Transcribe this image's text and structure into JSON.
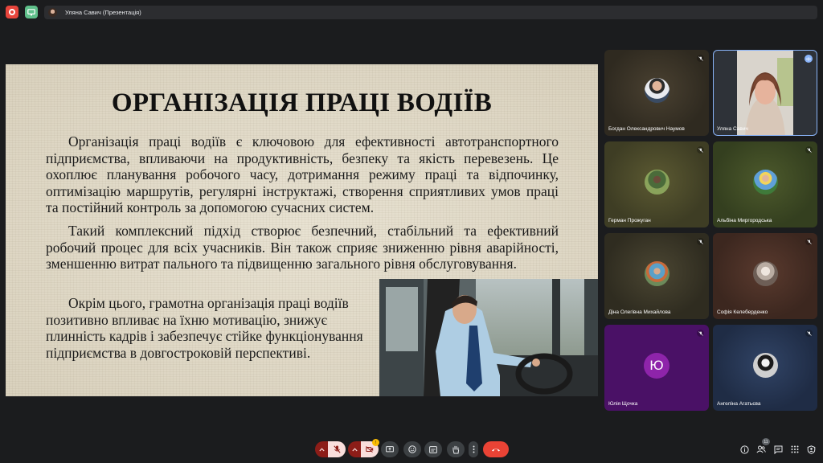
{
  "topbar": {
    "presentation_label": "Уляна Савич (Презентація)"
  },
  "slide": {
    "title": "ОРГАНІЗАЦІЯ ПРАЦІ ВОДІЇВ",
    "paragraph1": "Організація праці водіїв є ключовою для ефективності автотранспортного підприємства, впливаючи на продуктивність, безпеку та якість перевезень. Це охоплює планування робочого часу, дотримання режиму праці та відпочинку, оптимізацію маршрутів, регулярні інструктажі, створення сприятливих умов праці та постійний контроль за допомогою сучасних систем.",
    "paragraph2": "Такий комплексний підхід створює безпечний, стабільний та ефективний робочий процес для всіх учасників. Він також сприяє зниженню рівня аварійності, зменшенню витрат пального та підвищенню загального рівня обслуговування.",
    "paragraph3": "Окрім цього, грамотна організація праці водіїв позитивно впливає на їхню мотивацію, знижує плинність кадрів і забезпечує стійке функціонування підприємства в довгостроковій перспективі."
  },
  "participants": [
    {
      "name": "Богдан Олександрович Наумов",
      "kind": "photo",
      "muted": true
    },
    {
      "name": "Уляна Савич",
      "kind": "video",
      "muted": false,
      "speaking": true
    },
    {
      "name": "Герман Прожуган",
      "kind": "photo",
      "muted": true
    },
    {
      "name": "Альбіна Миргородська",
      "kind": "photo",
      "muted": true
    },
    {
      "name": "Діна Олегівна Михайлова",
      "kind": "photo",
      "muted": true
    },
    {
      "name": "Софія Келеберденко",
      "kind": "photo",
      "muted": true
    },
    {
      "name": "Юлія Щочка",
      "kind": "letter",
      "letter": "Ю",
      "muted": true
    },
    {
      "name": "Ангеліна Агатьєва",
      "kind": "photo",
      "muted": true
    }
  ],
  "controls": {
    "camera_badge": "!",
    "people_count": "11"
  },
  "colors": {
    "end_call": "#ea4335",
    "muted_red": "#8c1d18",
    "accent_blue": "#8ab4f8"
  }
}
